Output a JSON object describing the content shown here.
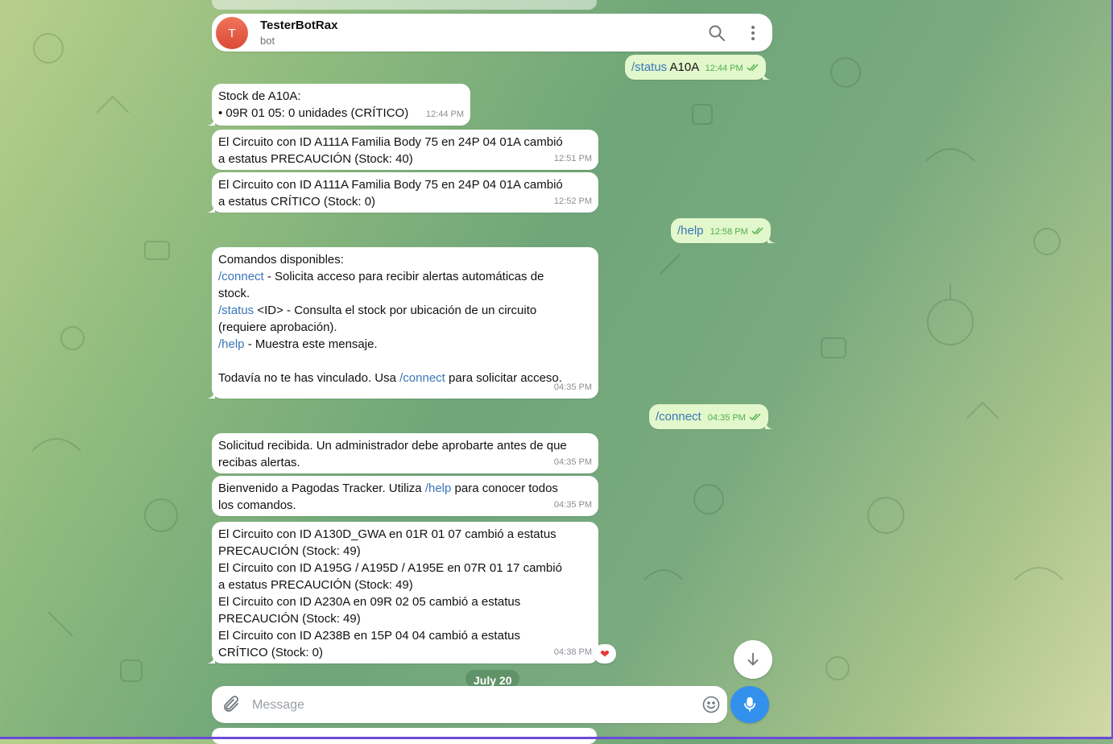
{
  "header": {
    "avatar_letter": "T",
    "title": "TesterBotRax",
    "subtitle": "bot",
    "icons": [
      "search-icon",
      "more-vertical-icon"
    ]
  },
  "messages": {
    "out1": {
      "command": "/status",
      "arg": "A10A",
      "time": "12:44 PM"
    },
    "in1": {
      "line1": "Stock de A10A:",
      "line2": "• 09R  01  05: 0 unidades (CRÍTICO)",
      "time": "12:44 PM"
    },
    "in2": {
      "line1": "El Circuito con ID A111A Familia Body 75 en 24P  04  01A cambió",
      "line2": "a estatus PRECAUCIÓN (Stock: 40)",
      "time": "12:51 PM"
    },
    "in3": {
      "line1": "El Circuito con ID A111A Familia Body 75 en 24P  04  01A cambió",
      "line2": "a estatus CRÍTICO (Stock: 0)",
      "time": "12:52 PM"
    },
    "out2": {
      "command": "/help",
      "time": "12:58 PM"
    },
    "in4": {
      "l1": "Comandos disponibles:",
      "connect_cmd": "/connect",
      "connect_desc": " - Solicita acceso para recibir alertas automáticas de",
      "connect_desc2": "stock.",
      "status_cmd": "/status",
      "status_desc": " <ID> - Consulta el stock por ubicación de un circuito",
      "status_desc2": "(requiere aprobación).",
      "help_cmd": "/help",
      "help_desc": " - Muestra este mensaje.",
      "last_pre": "Todavía no te has vinculado. Usa ",
      "last_cmd": "/connect",
      "last_post": " para solicitar acceso.",
      "time": "04:35 PM"
    },
    "out3": {
      "command": "/connect",
      "time": "04:35 PM"
    },
    "in5": {
      "line1": "Solicitud recibida. Un administrador debe aprobarte antes de que",
      "line2": "recibas alertas.",
      "time": "04:35 PM"
    },
    "in6": {
      "pre": "Bienvenido a Pagodas Tracker. Utiliza ",
      "cmd": "/help",
      "post": " para conocer todos",
      "line2": "los comandos.",
      "time": "04:35 PM"
    },
    "in7": {
      "lines": [
        "El Circuito con ID A130D_GWA en 01R  01  07 cambió a estatus",
        "PRECAUCIÓN (Stock: 49)",
        "El Circuito con ID A195G / A195D / A195E en 07R  01  17 cambió",
        "a estatus PRECAUCIÓN (Stock: 49)",
        "El Circuito con ID A230A en 09R  02  05 cambió a estatus",
        "PRECAUCIÓN (Stock: 49)",
        "El Circuito con ID A238B en 15P  04  04 cambió a estatus",
        "CRÍTICO (Stock: 0)"
      ],
      "time": "04:38 PM",
      "reaction": "❤"
    }
  },
  "date_chip": "July 20",
  "composer": {
    "placeholder": "Message"
  },
  "colors": {
    "accent": "#3390ec",
    "out_bubble": "#e2f7cb",
    "link": "#3a76b8"
  }
}
